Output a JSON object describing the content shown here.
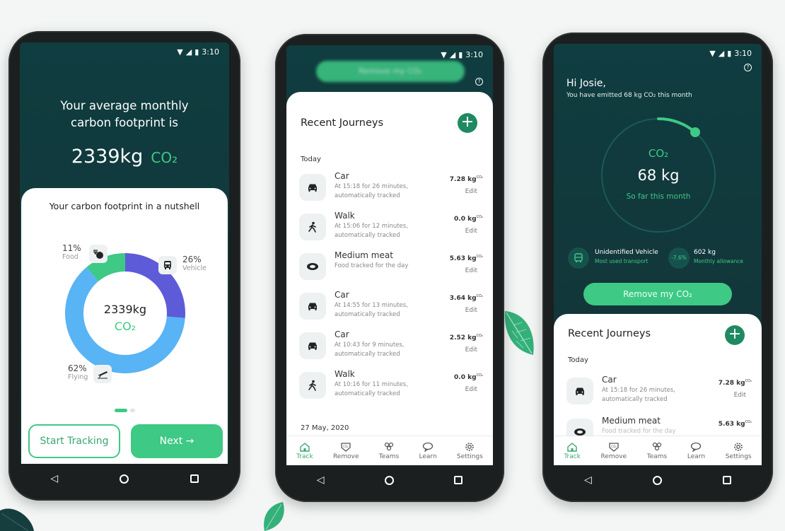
{
  "status": {
    "time": "3:10"
  },
  "phone1": {
    "headline_line1": "Your average monthly",
    "headline_line2": "carbon footprint is",
    "amount": "2339kg",
    "unit": "CO₂",
    "card_title": "Your carbon footprint in a nutshell",
    "center_amount": "2339kg",
    "center_unit": "CO₂",
    "segments": [
      {
        "label": "Food",
        "pct": "11%",
        "value": 11,
        "color": "#3ec985",
        "icon": "food-icon"
      },
      {
        "label": "Vehicle",
        "pct": "26%",
        "value": 26,
        "color": "#5e5bd8",
        "icon": "bus-icon"
      },
      {
        "label": "Flying",
        "pct": "62%",
        "value": 62,
        "color": "#58b4f4",
        "icon": "plane-icon"
      }
    ],
    "start_label": "Start Tracking",
    "next_label": "Next →"
  },
  "phone2": {
    "header_button": "Remove my CO₂",
    "title": "Recent Journeys",
    "section_today": "Today",
    "section_date": "27 May, 2020",
    "journeys": [
      {
        "title": "Car",
        "sub1": "At 15:18 for 26 minutes,",
        "sub2": "automatically tracked",
        "kg": "7.28 kg",
        "edit": "Edit",
        "icon": "car-icon"
      },
      {
        "title": "Walk",
        "sub1": "At 15:06 for 12 minutes,",
        "sub2": "automatically tracked",
        "kg": "0.0 kg",
        "edit": "Edit",
        "icon": "walk-icon"
      },
      {
        "title": "Medium meat",
        "sub1": "Food tracked for the day",
        "sub2": "",
        "kg": "5.63 kg",
        "edit": "Edit",
        "icon": "meat-icon"
      },
      {
        "title": "Car",
        "sub1": "At 14:55 for 13 minutes,",
        "sub2": "automatically tracked",
        "kg": "3.64 kg",
        "edit": "Edit",
        "icon": "car-icon"
      },
      {
        "title": "Car",
        "sub1": "At 10:43 for 9 minutes,",
        "sub2": "automatically tracked",
        "kg": "2.52 kg",
        "edit": "Edit",
        "icon": "car-icon"
      },
      {
        "title": "Walk",
        "sub1": "At 10:16 for 11 minutes,",
        "sub2": "automatically tracked",
        "kg": "0.0 kg",
        "edit": "Edit",
        "icon": "walk-icon"
      }
    ],
    "co2_sup": "CO₂"
  },
  "phone3": {
    "greeting": "Hi Josie,",
    "subline": "You have emitted 68 kg CO₂ this month",
    "ring_label": "CO₂",
    "ring_value": "68 kg",
    "ring_caption": "So far this month",
    "stat1_title": "Unidentified Vehicle",
    "stat1_sub": "Most used transport",
    "stat2_badge": "-7.6%",
    "stat2_title": "602 kg",
    "stat2_sub": "Monthly allowance",
    "remove_label": "Remove my CO₂",
    "title": "Recent Journeys",
    "section_today": "Today",
    "j1_title": "Car",
    "j1_sub1": "At 15:18 for 26 minutes,",
    "j1_sub2": "automatically tracked",
    "j1_kg": "7.28 kg",
    "j1_edit": "Edit",
    "j2_title": "Medium meat",
    "j2_sub1": "Food tracked for the day",
    "j2_kg": "5.63 kg"
  },
  "tabs": [
    {
      "label": "Track",
      "icon": "home-icon"
    },
    {
      "label": "Remove",
      "icon": "co2-badge-icon"
    },
    {
      "label": "Teams",
      "icon": "teams-icon"
    },
    {
      "label": "Learn",
      "icon": "chat-icon"
    },
    {
      "label": "Settings",
      "icon": "gear-icon"
    }
  ],
  "colors": {
    "accent": "#3ec985",
    "dark_teal": "#0f3d40",
    "add_button": "#1f8a62"
  }
}
